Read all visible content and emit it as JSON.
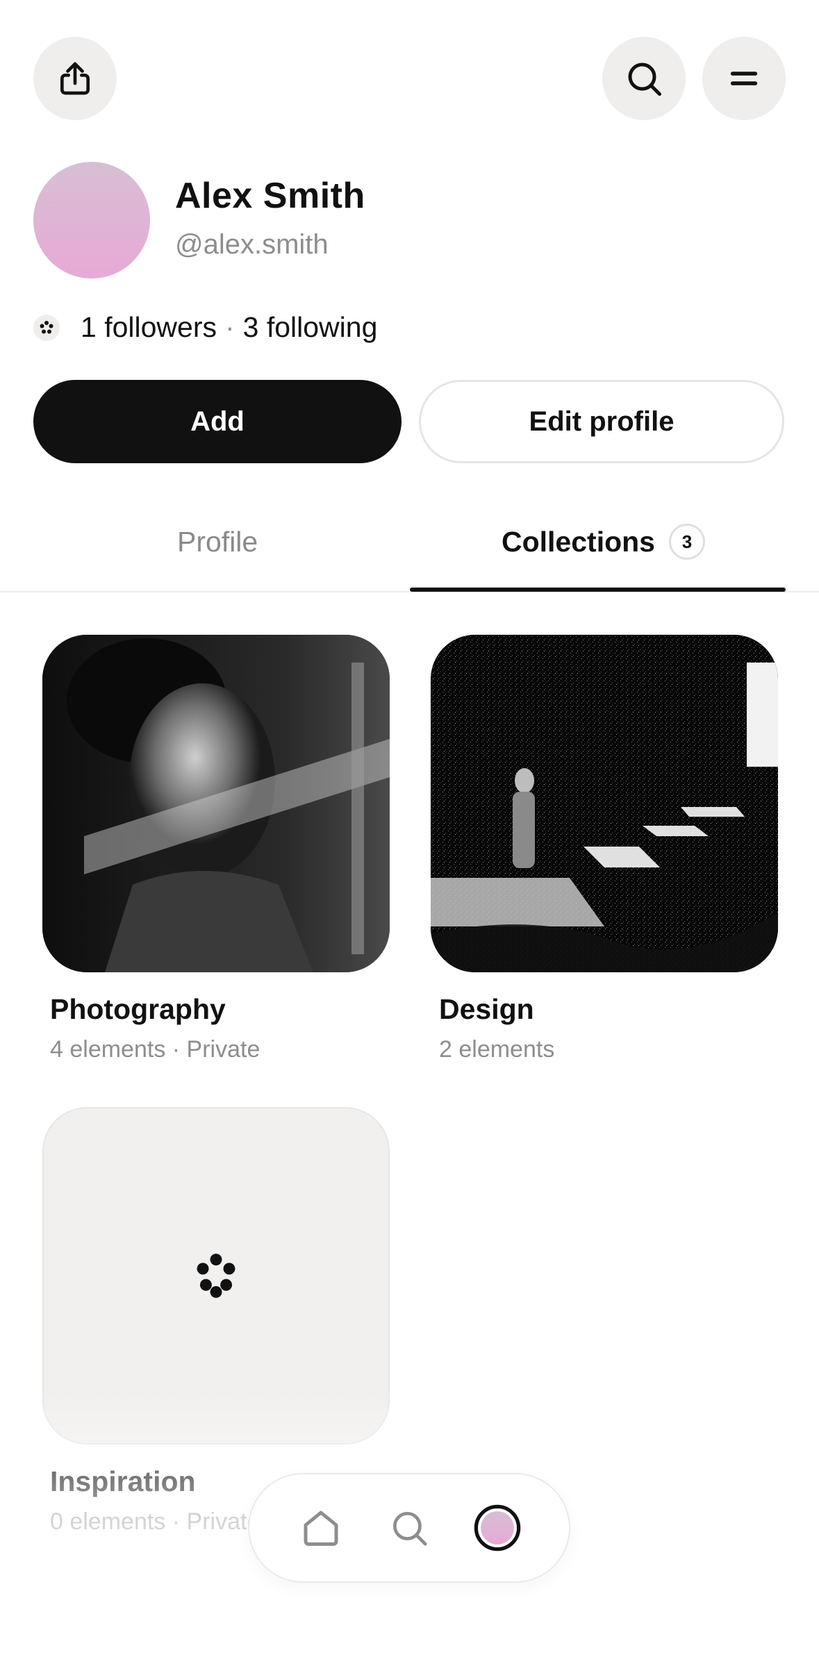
{
  "header": {
    "share_icon": "share-icon",
    "search_icon": "search-icon",
    "menu_icon": "menu-icon"
  },
  "profile": {
    "name": "Alex Smith",
    "handle": "@alex.smith",
    "followers": "1 followers",
    "separator": "·",
    "following": "3 following",
    "avatar_colors": [
      "#d6bfd3",
      "#e8a9d7"
    ]
  },
  "actions": {
    "add_label": "Add",
    "edit_label": "Edit profile"
  },
  "tabs": {
    "profile_label": "Profile",
    "collections_label": "Collections",
    "collections_count": "3"
  },
  "collections": [
    {
      "title": "Photography",
      "meta": "4 elements · Private",
      "image": "black-and-white portrait of a woman with light streak"
    },
    {
      "title": "Design",
      "meta": "2 elements",
      "image": "black-and-white figure standing near steps"
    },
    {
      "title": "Inspiration",
      "meta": "0 elements · Private",
      "image": "empty-placeholder-icon"
    }
  ],
  "bottom_nav": {
    "home_icon": "home-icon",
    "search_icon": "search-icon",
    "profile_icon": "avatar-icon"
  }
}
